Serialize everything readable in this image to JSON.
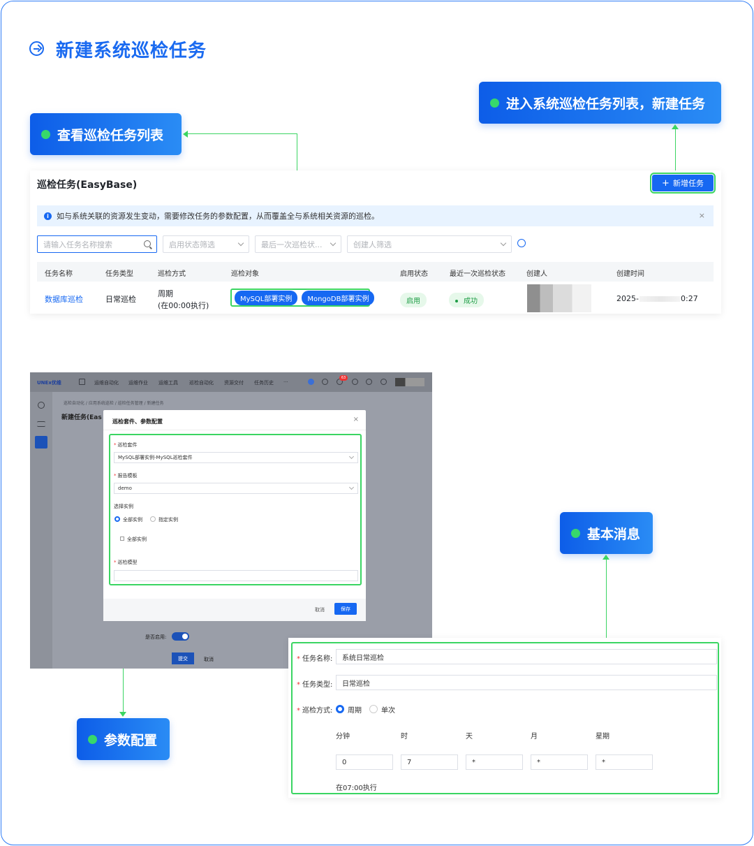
{
  "page": {
    "title": "新建系统巡检任务"
  },
  "callouts": {
    "list": "查看巡检任务列表",
    "create": "进入系统巡检任务列表，新建任务",
    "basic": "基本消息",
    "params": "参数配置"
  },
  "task_list": {
    "title": "巡检任务(EasyBase)",
    "add_button": "新增任务",
    "notice": "如与系统关联的资源发生变动，需要修改任务的参数配置，从而覆盖全与系统相关资源的巡检。",
    "filters": {
      "search_placeholder": "请输入任务名称搜索",
      "status": "启用状态筛选",
      "last_status": "最后一次巡检状...",
      "creator": "创建人筛选"
    },
    "columns": [
      "任务名称",
      "任务类型",
      "巡检方式",
      "巡检对象",
      "启用状态",
      "最近一次巡检状态",
      "创建人",
      "创建时间"
    ],
    "row": {
      "name": "数据库巡检",
      "type": "日常巡检",
      "mode_line1": "周期",
      "mode_line2": "(在00:00执行)",
      "targets": [
        "MySQL部署实例",
        "MongoDB部署实例"
      ],
      "enabled": "启用",
      "last_status": "成功",
      "created_prefix": "2025-",
      "created_suffix": "0:27"
    }
  },
  "app": {
    "logo": "UNEx优维",
    "nav": [
      "运维自动化",
      "运维作业",
      "运维工具",
      "巡检自动化",
      "资源交付",
      "任务历史",
      "···"
    ],
    "badge": "63",
    "breadcrumb": "巡检自动化 / 应用系统巡检 / 巡检任务管理 / 新建任务",
    "heading": "新建任务(Eas",
    "modal": {
      "title": "巡检套件、参数配置",
      "suite_label": "巡检套件",
      "suite_value": "MySQL部署实例-MySQL巡检套件",
      "template_label": "报告模板",
      "template_value": "demo",
      "instance_label": "选择实例",
      "opt_all": "全部实例",
      "opt_specific": "指定实例",
      "all_instances": "全部实例",
      "model_label": "巡检模型",
      "cancel": "取消",
      "save": "保存"
    },
    "enable_label": "是否启用:",
    "submit": "提交",
    "cancel": "取消"
  },
  "basic_form": {
    "name_label": "任务名称:",
    "name_value": "系统日常巡检",
    "type_label": "任务类型:",
    "type_value": "日常巡检",
    "mode_label": "巡检方式:",
    "mode_periodic": "周期",
    "mode_once": "单次",
    "cron_headers": [
      "分钟",
      "时",
      "天",
      "月",
      "星期"
    ],
    "cron_values": [
      "0",
      "7",
      "*",
      "*",
      "*"
    ],
    "exec_text": "在07:00执行"
  },
  "colors": {
    "accent": "#1668f2",
    "highlight": "#3ad562",
    "title": "#1a6af0"
  }
}
